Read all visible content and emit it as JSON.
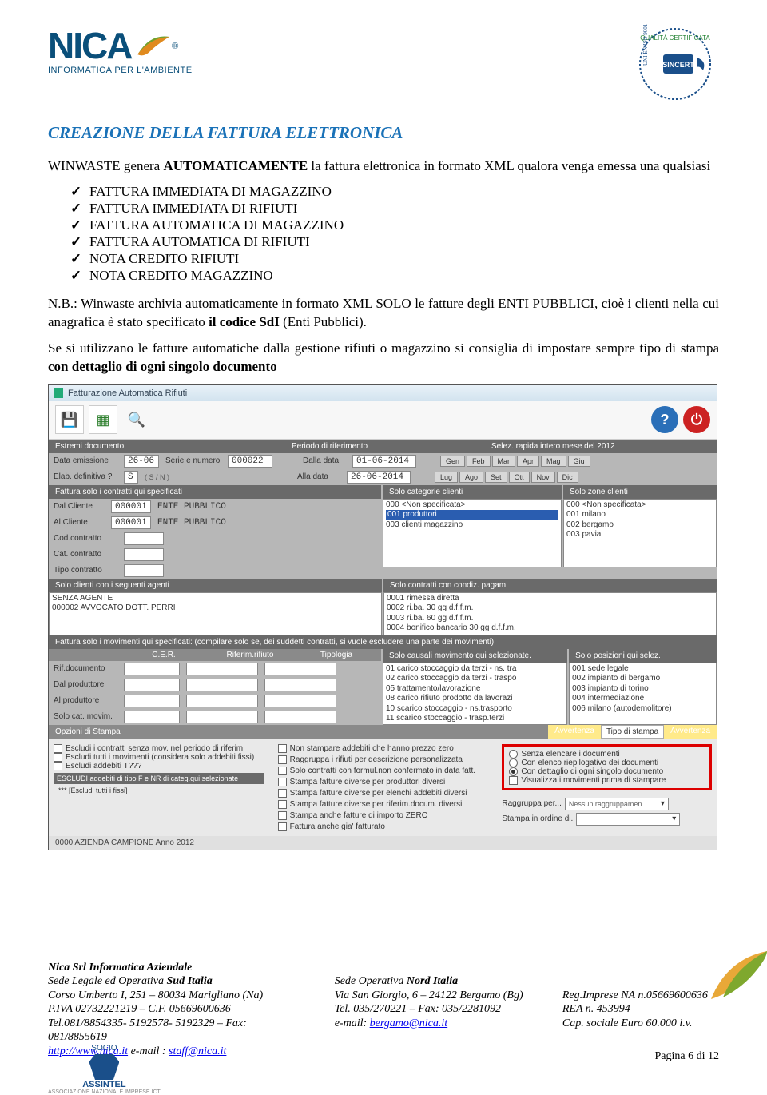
{
  "header": {
    "logo_text": "NICA",
    "logo_sub": "INFORMATICA PER L'AMBIENTE",
    "reg_mark": "®"
  },
  "title": "CREAZIONE DELLA FATTURA  ELETTRONICA",
  "intro": {
    "pre": "WINWASTE genera ",
    "auto": "AUTOMATICAMENTE",
    "post": " la fattura elettronica  in formato XML qualora venga emessa una qualsiasi"
  },
  "checklist": [
    "FATTURA IMMEDIATA DI MAGAZZINO",
    "FATTURA IMMEDIATA DI RIFIUTI",
    "FATTURA AUTOMATICA DI MAGAZZINO",
    "FATTURA AUTOMATICA DI RIFIUTI",
    "NOTA CREDITO RIFIUTI",
    "NOTA CREDITO MAGAZZINO"
  ],
  "nb": {
    "prefix": "N.B.:",
    "body": " Winwaste archivia automaticamente in formato XML SOLO le fatture degli ENTI PUBBLICI, cioè i clienti nella cui  anagrafica è stato specificato ",
    "bold": "il codice SdI",
    "tail": " (Enti Pubblici)."
  },
  "advice": {
    "a": "Se si utilizzano le fatture automatiche  dalla gestione rifiuti o magazzino si consiglia  di impostare sempre tipo di stampa ",
    "b": "con dettaglio di ogni singolo documento"
  },
  "screenshot": {
    "title": "Fatturazione Automatica Rifiuti",
    "section_bar": {
      "a": "Estremi documento",
      "b": "Periodo di riferimento",
      "c": "Selez. rapida intero mese del 2012"
    },
    "row1": {
      "data_emiss_lbl": "Data emissione",
      "data_emiss_val": "26-06",
      "serie_lbl": "Serie e numero",
      "serie_val": "000022",
      "dalla_lbl": "Dalla data",
      "dalla_val": "01-06-2014",
      "months_a": [
        "Gen",
        "Feb",
        "Mar",
        "Apr",
        "Mag",
        "Giu"
      ]
    },
    "row2": {
      "elab_lbl": "Elab. definitiva ?",
      "elab_val": "S",
      "elab_hint": "( S / N )",
      "alla_lbl": "Alla data",
      "alla_val": "26-06-2014",
      "months_b": [
        "Lug",
        "Ago",
        "Set",
        "Ott",
        "Nov",
        "Dic"
      ]
    },
    "bar_contracts": "Fattura solo i contratti qui specificati",
    "bar_cat": "Solo categorie clienti",
    "bar_zone": "Solo zone clienti",
    "clients": {
      "dal_lbl": "Dal Cliente",
      "dal_code": "000001",
      "dal_name": "ENTE PUBBLICO",
      "al_lbl": "Al Cliente",
      "al_code": "000001",
      "al_name": "ENTE PUBBLICO",
      "cod_lbl": "Cod.contratto",
      "cat_lbl": "Cat. contratto",
      "tipo_lbl": "Tipo contratto"
    },
    "cat_list": [
      "000 <Non specificata>",
      "001 produttori",
      "003 clienti magazzino"
    ],
    "zone_list": [
      "000 <Non specificata>",
      "001 milano",
      "002 bergamo",
      "003 pavia"
    ],
    "bar_agents": "Solo clienti con i seguenti agenti",
    "bar_pagam": "Solo contratti con condiz. pagam.",
    "agents_list": [
      "SENZA AGENTE",
      "000002 AVVOCATO DOTT. PERRI"
    ],
    "pagam_list": [
      "0001 rimessa diretta",
      "0002 ri.ba. 30 gg d.f.f.m.",
      "0003 ri.ba. 60 gg d.f.f.m.",
      "0004 bonifico bancario 30 gg d.f.f.m."
    ],
    "bar_mov": "Fattura solo i movimenti qui specificati: (compilare solo se, dei suddetti contratti, si vuole escludere una parte dei movimenti)",
    "mov_cols": [
      "C.E.R.",
      "Riferim.rifiuto",
      "Tipologia"
    ],
    "mov_labels": [
      "Rif.documento",
      "Dal produttore",
      "Al produttore",
      "Solo cat. movim."
    ],
    "bar_causali": "Solo causali movimento qui selezionate.",
    "bar_posiz": "Solo posizioni qui selez.",
    "causali_list": [
      "01 carico stoccaggio da terzi - ns. tra",
      "02 carico stoccaggio da terzi - traspo",
      "05 trattamento/lavorazione",
      "08 carico rifiuto prodotto da lavorazi",
      "10 scarico stoccaggio - ns.trasporto",
      "11 scarico stoccaggio - trasp.terzi"
    ],
    "posiz_list": [
      "001 sede legale",
      "002 impianto di bergamo",
      "003 impianto di torino",
      "004 intermediazione",
      "006 milano (autodemolitore)"
    ],
    "opts_bar": "Opzioni di Stampa",
    "tab_avvert": "Avvertenza",
    "tab_tipo": "Tipo di stampa",
    "opts_col1": [
      "Escludi i contratti senza mov. nel periodo di riferim.",
      "Escludi tutti i movimenti (considera solo addebiti fissi)",
      "Escludi addebiti T???"
    ],
    "opts_escludi": "ESCLUDI addebiti di tipo F e NR di categ.qui selezionate",
    "opts_escludi_sub": "*** [Escludi tutti i fissi]",
    "opts_col2": [
      "Non stampare addebiti che hanno prezzo zero",
      "Raggruppa i rifiuti per descrizione personalizzata",
      "Solo contratti con formul.non confermato in data fatt.",
      "Stampa fatture diverse per produttori diversi",
      "Stampa fatture diverse per elenchi addebiti diversi",
      "Stampa fatture diverse per riferim.docum. diversi",
      "Stampa anche fatture di importo ZERO",
      "Fattura anche gia' fatturato"
    ],
    "opts_col3": [
      "Senza elencare i documenti",
      "Con elenco riepilogativo dei documenti",
      "Con dettaglio di ogni singolo documento",
      "Visualizza i movimenti prima di stampare"
    ],
    "ragr_lbl": "Raggruppa per...",
    "ragr_val": "Nessun raggruppamen",
    "ordine_lbl": "Stampa in ordine di.",
    "status": "0000 AZIENDA CAMPIONE   Anno 2012"
  },
  "footer": {
    "company": "Nica Srl  Informatica Aziendale",
    "l1": "Sede Legale ed Operativa ",
    "l1b": "Sud Italia",
    "l2": "Corso Umberto I, 251 – 80034 Marigliano (Na)",
    "l3": "P.IVA 02732221219 – C.F. 05669600636",
    "l4": "Tel.081/8854335- 5192578- 5192329 – Fax: 081/8855619",
    "l5a": "http://www.nica.it",
    "l5b": "   e-mail : ",
    "l5c": "staff@nica.it",
    "c1": "Sede Operativa ",
    "c1b": "Nord Italia",
    "c2": "Via San Giorgio, 6 – 24122 Bergamo (Bg)",
    "c3": "Tel. 035/270221 – Fax: 035/2281092",
    "c4": "e-mail: ",
    "c4b": "bergamo@nica.it",
    "r1": "Reg.Imprese NA n.05669600636",
    "r2": "REA n. 453994",
    "r3": "Cap. sociale Euro 60.000 i.v.",
    "assintel_socio": "SOCIO",
    "assintel": "ASSINTEL",
    "assintel_sub": "ASSOCIAZIONE NAZIONALE IMPRESE ICT",
    "pagenum": "Pagina 6 di 12"
  }
}
